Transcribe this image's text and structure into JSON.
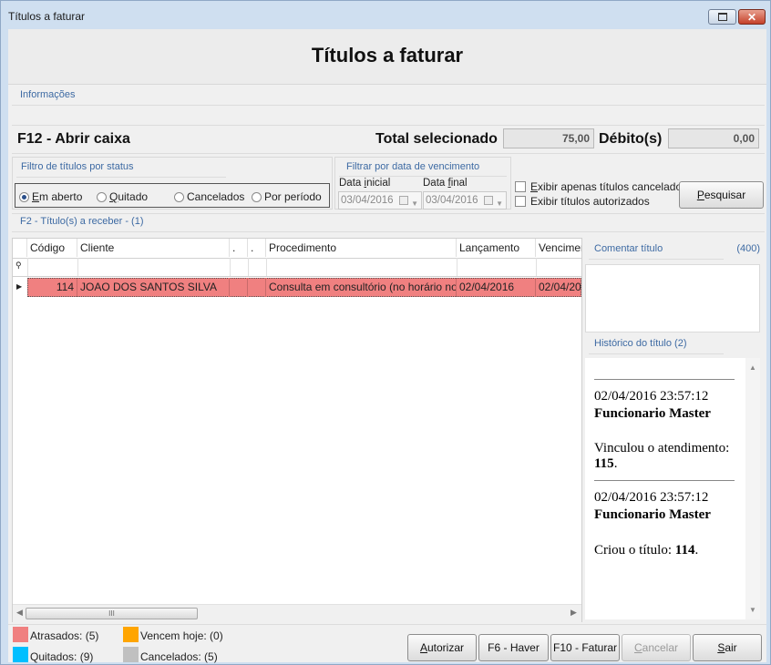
{
  "window": {
    "title": "Títulos a faturar",
    "close_glyph": "✕"
  },
  "header": {
    "title": "Títulos a faturar"
  },
  "info": {
    "group_label": "Informações",
    "abrir_caixa": "F12 - Abrir caixa",
    "total_label": "Total selecionado",
    "total_value": "75,00",
    "debito_label": "Débito(s)",
    "debito_value": "0,00"
  },
  "status_filter": {
    "label": "Filtro de títulos por status",
    "options": [
      {
        "label_u": "E",
        "label_rest": "m aberto",
        "selected": true
      },
      {
        "label_u": "Q",
        "label_rest": "uitado",
        "selected": false
      },
      {
        "label_u": "",
        "label_rest": "Cancelados",
        "selected": false
      },
      {
        "label_u": "",
        "label_rest": "Por período",
        "selected": false
      }
    ]
  },
  "date_filter": {
    "label": "Filtrar por data de vencimento",
    "start_label_u": "Data ",
    "start_label_ul": "i",
    "start_label_rest": "nicial",
    "start_value": "03/04/2016",
    "end_label_u": "Data ",
    "end_label_ul": "f",
    "end_label_rest": "inal",
    "end_value": "03/04/2016"
  },
  "checkboxes": {
    "cancelados_u": "E",
    "cancelados_rest": "xibir apenas títulos cancelados",
    "autorizados": "Exibir títulos autorizados"
  },
  "pesquisar": {
    "u": "P",
    "rest": "esquisar"
  },
  "grid": {
    "section_label": "F2 - Título(s) a receber - (1)",
    "columns": [
      "Código",
      "Cliente",
      ".",
      ".",
      "Procedimento",
      "Lançamento",
      "Venciment"
    ],
    "rows": [
      {
        "codigo": "114",
        "cliente": "JOAO DOS SANTOS SILVA",
        "c1": "",
        "c2": "",
        "procedimento": "Consulta em consultório (no horário nor…",
        "lancamento": "02/04/2016",
        "vencimento": "02/04/20"
      }
    ],
    "row_color": "#f08080",
    "scroll_glyph": "III"
  },
  "comment": {
    "label": "Comentar título",
    "count": "(400)"
  },
  "history": {
    "label": "Histórico do título (2)",
    "entries": [
      {
        "datetime": "02/04/2016 23:57:12",
        "author": "Funcionario Master",
        "text_prefix": "Vinculou o atendimento: ",
        "text_bold": "115",
        "text_suffix": "."
      },
      {
        "datetime": "02/04/2016 23:57:12",
        "author": "Funcionario Master",
        "text_prefix": "Criou o título: ",
        "text_bold": "114",
        "text_suffix": "."
      }
    ]
  },
  "legend": [
    {
      "label": "Atrasados: (5)",
      "color": "#f08080"
    },
    {
      "label": "Vencem hoje: (0)",
      "color": "#ffa500"
    },
    {
      "label": "Quitados: (9)",
      "color": "#00bfff"
    },
    {
      "label": "Cancelados: (5)",
      "color": "#c0c0c0"
    }
  ],
  "buttons": {
    "autorizar_u": "A",
    "autorizar_rest": "utorizar",
    "haver": "F6 - Haver",
    "faturar": "F10 - Faturar",
    "cancelar_u": "C",
    "cancelar_rest": "ancelar",
    "sair_u": "S",
    "sair_rest": "air"
  }
}
